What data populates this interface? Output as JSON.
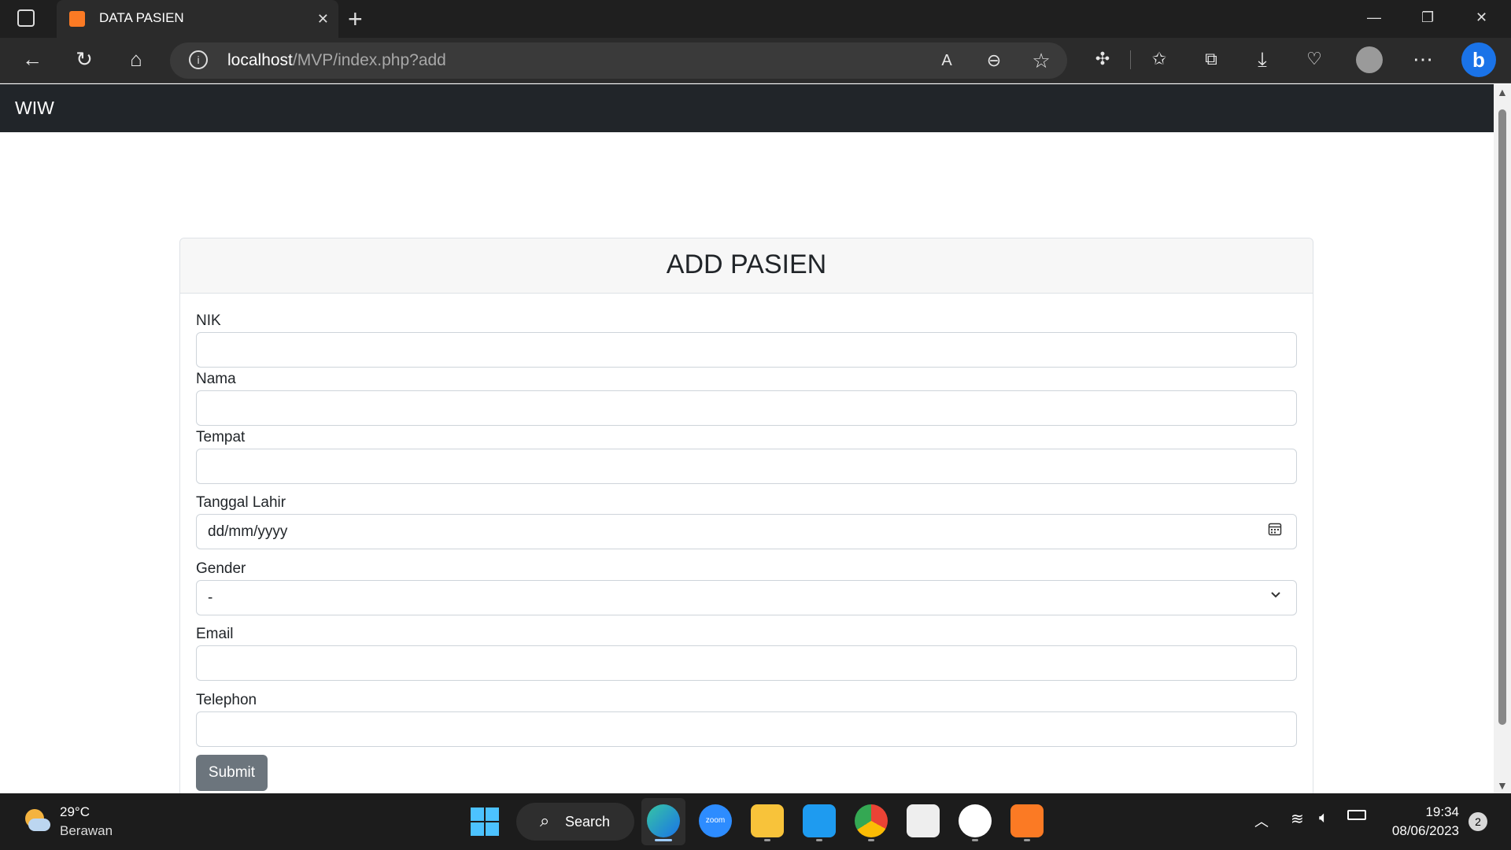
{
  "browser": {
    "tab_title": "DATA PASIEN",
    "tab_close": "✕",
    "new_tab": "+",
    "url_host": "localhost",
    "url_path": "/MVP/index.php?add",
    "window_controls": [
      "—",
      "❐",
      "✕"
    ]
  },
  "navbar": {
    "brand": "WIW"
  },
  "form": {
    "title": "ADD PASIEN",
    "fields": [
      {
        "label": "NIK",
        "value": ""
      },
      {
        "label": "Nama",
        "value": ""
      },
      {
        "label": "Tempat",
        "value": ""
      },
      {
        "label": "Tanggal Lahir",
        "placeholder": "dd/mm/yyyy"
      },
      {
        "label": "Gender",
        "selected": "-"
      },
      {
        "label": "Email",
        "value": ""
      },
      {
        "label": "Telephon",
        "value": ""
      }
    ],
    "submit_label": "Submit"
  },
  "taskbar": {
    "temperature": "29°C",
    "weather": "Berawan",
    "search_label": "Search",
    "time": "19:34",
    "date": "08/06/2023",
    "notification_count": "2",
    "apps": [
      "edge-icon",
      "zoom-icon",
      "file-explorer-icon",
      "vscode-icon",
      "chrome-icon",
      "snipping-tool-icon",
      "notepad-icon",
      "xampp-icon"
    ]
  },
  "colors": {
    "navbar_bg": "#212529",
    "submit_bg": "#6c757d",
    "tab_favicon": "#fb7a24"
  }
}
